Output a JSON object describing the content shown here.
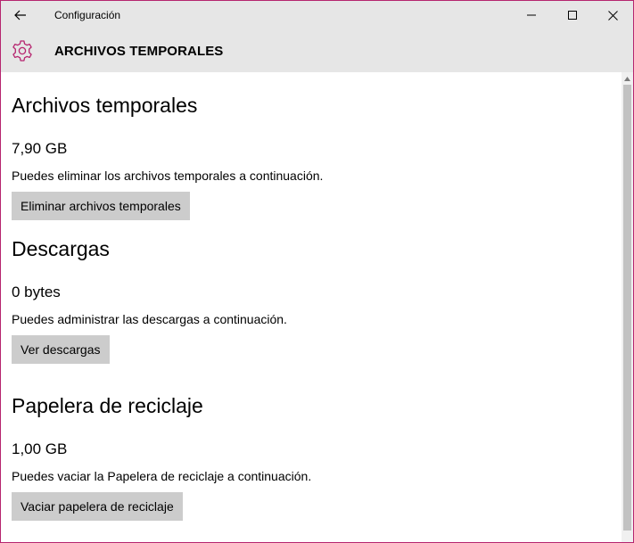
{
  "window": {
    "app_title": "Configuración"
  },
  "header": {
    "page_title": "ARCHIVOS TEMPORALES"
  },
  "sections": [
    {
      "title": "Archivos temporales",
      "size": "7,90 GB",
      "description": "Puedes eliminar los archivos temporales a continuación.",
      "button": "Eliminar archivos temporales"
    },
    {
      "title": "Descargas",
      "size": "0 bytes",
      "description": "Puedes administrar las descargas a continuación.",
      "button": "Ver descargas"
    },
    {
      "title": "Papelera de reciclaje",
      "size": "1,00 GB",
      "description": "Puedes vaciar la Papelera de reciclaje a continuación.",
      "button": "Vaciar papelera de reciclaje"
    }
  ],
  "colors": {
    "accent": "#b6256f",
    "chrome": "#e6e6e6",
    "button": "#cccccc"
  }
}
